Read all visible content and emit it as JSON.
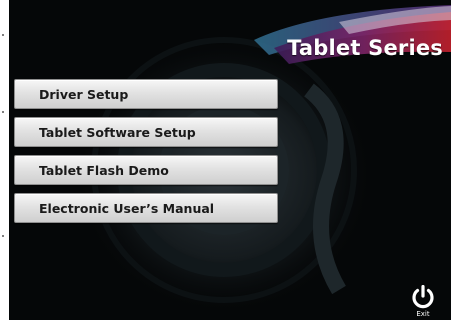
{
  "header": {
    "title": "Tablet Series"
  },
  "menu": {
    "items": [
      {
        "label": "Driver Setup"
      },
      {
        "label": "Tablet Software Setup"
      },
      {
        "label": "Tablet Flash Demo"
      },
      {
        "label": "Electronic User’s Manual"
      }
    ]
  },
  "exit": {
    "label": "Exit",
    "icon": "power-icon"
  },
  "colors": {
    "background": "#050708",
    "accent_red": "#c4212c",
    "brush_purple": "#6b2a7a",
    "button_face": "#e2e2e2"
  }
}
